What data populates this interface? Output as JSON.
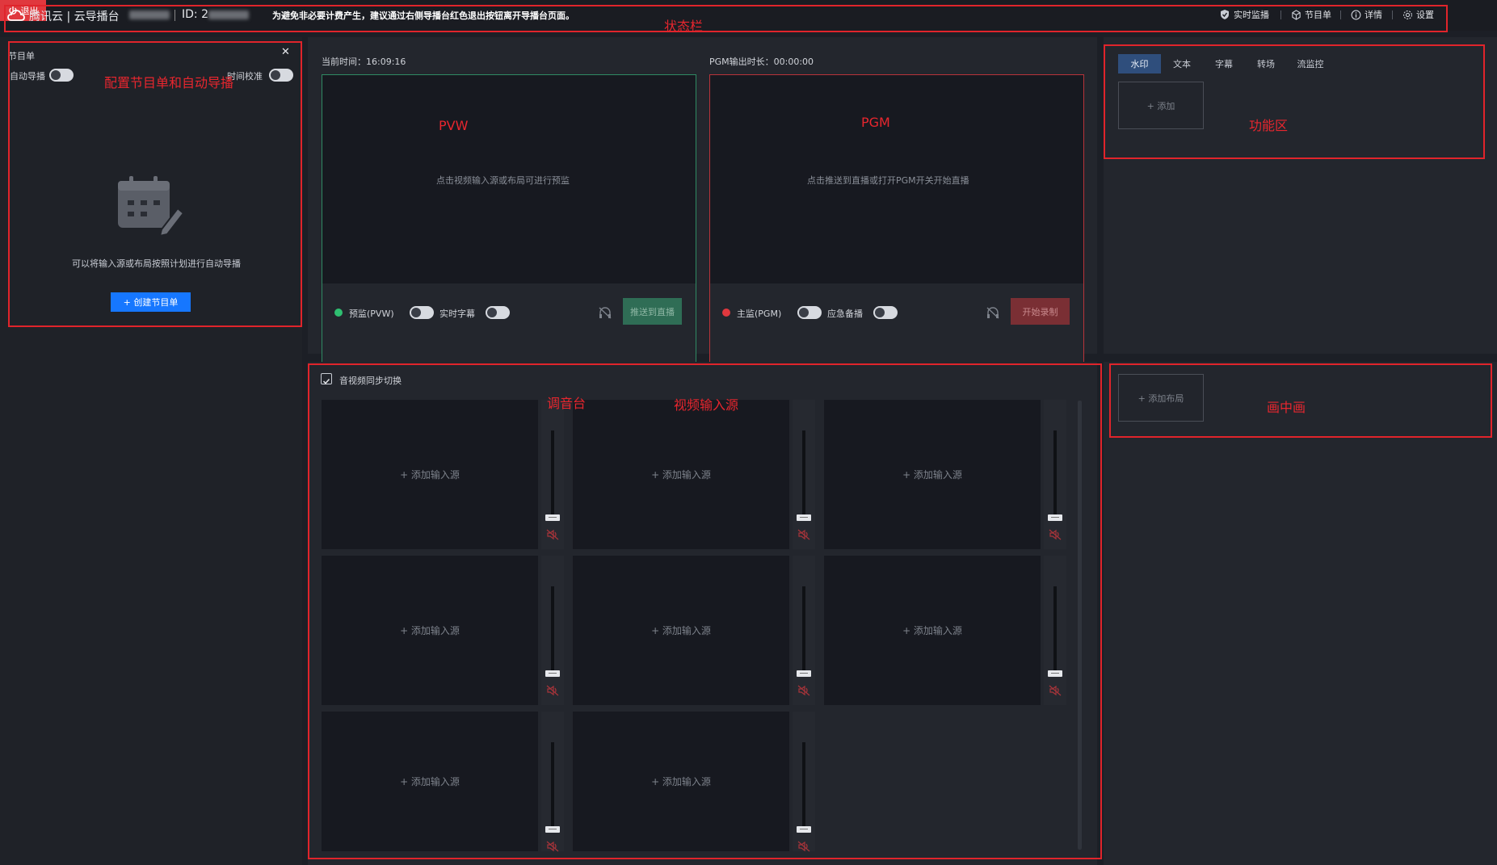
{
  "statusbar": {
    "brand": "腾讯云 | 云导播台",
    "id_label": "ID: 2",
    "notice": "为避免非必要计费产生，建议通过右侧导播台红色退出按钮离开导播台页面。",
    "items": [
      "实时监播",
      "节目单",
      "详情",
      "设置"
    ],
    "exit_label": "退出"
  },
  "schedule": {
    "title": "节目单",
    "auto_label": "自动导播",
    "time_label": "时间校准",
    "empty_hint": "可以将输入源或布局按照计划进行自动导播",
    "create_label": "+ 创建节目单"
  },
  "preview": {
    "time_label": "当前时间：16:09:16",
    "hint": "点击视频输入源或布局可进行预监",
    "monitor_label": "预监(PVW)",
    "subtitle_label": "实时字幕",
    "push_label": "推送到直播",
    "dot_color": "#2fbf71"
  },
  "program": {
    "time_label": "PGM输出时长：00:00:00",
    "hint": "点击推送到直播或打开PGM开关开始直播",
    "monitor_label": "主监(PGM)",
    "backup_label": "应急备播",
    "record_label": "开始录制",
    "dot_color": "#e0383e"
  },
  "function_area": {
    "tabs": [
      "水印",
      "文本",
      "字幕",
      "转场",
      "流监控"
    ],
    "add_label": "+ 添加"
  },
  "inputs": {
    "sync_label": "音视频同步切换",
    "add_source_label": "+ 添加输入源"
  },
  "pip": {
    "add_layout_label": "+ 添加布局"
  },
  "annotations": {
    "statusbar": "状态栏",
    "schedule": "配置节目单和自动导播",
    "pvw": "PVW",
    "pgm": "PGM",
    "function": "功能区",
    "mixer": "调音台",
    "video_input": "视频输入源",
    "pip": "画中画"
  },
  "colors": {
    "accent": "#1677ff",
    "annotation": "#e8262e",
    "pvw_border": "#2f8a63",
    "pgm_border": "#b8343a"
  }
}
